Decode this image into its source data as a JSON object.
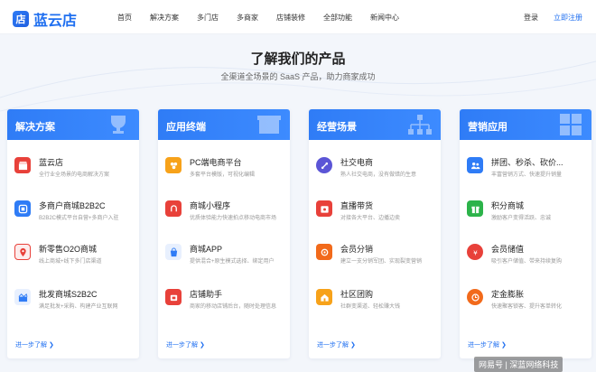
{
  "header": {
    "logo_mark": "店",
    "logo_text": "蓝云店",
    "nav": [
      "首页",
      "解决方案",
      "多门店",
      "多商家",
      "店铺装修",
      "全部功能",
      "新闻中心"
    ],
    "login": "登录",
    "register": "立即注册"
  },
  "hero": {
    "title": "了解我们的产品",
    "subtitle": "全渠道全场景的 SaaS 产品，助力商家成功"
  },
  "cards": [
    {
      "title": "解决方案",
      "more": "进一步了解 ❯",
      "items": [
        {
          "title": "蓝云店",
          "desc": "全行业全场景的电商解决方案",
          "icon": "store-icon",
          "color": "#e8413a"
        },
        {
          "title": "多商户商城B2B2C",
          "desc": "B2B2C模式平台自营+多商户入驻",
          "icon": "multi-store-icon",
          "color": "#2f7cf6"
        },
        {
          "title": "新零售O2O商城",
          "desc": "线上商城+线下多门店渠道",
          "icon": "location-icon",
          "color": "#e8413a"
        },
        {
          "title": "批发商城S2B2C",
          "desc": "满足批发+采购、构建产业互联网",
          "icon": "wholesale-icon",
          "color": "#2f7cf6"
        }
      ]
    },
    {
      "title": "应用终端",
      "more": "进一步了解 ❯",
      "items": [
        {
          "title": "PC端电商平台",
          "desc": "多套平台模版，可视化编辑",
          "icon": "pc-icon",
          "color": "#f7a21a"
        },
        {
          "title": "商城小程序",
          "desc": "优质体验能力快速拍点移动电商市场",
          "icon": "mini-program-icon",
          "color": "#e8413a"
        },
        {
          "title": "商城APP",
          "desc": "提供混合+原生模式选择、绑定用户",
          "icon": "app-icon",
          "color": "#2f7cf6"
        },
        {
          "title": "店铺助手",
          "desc": "商家的移动店铺后台，随时处理信息",
          "icon": "assistant-icon",
          "color": "#e8413a"
        }
      ]
    },
    {
      "title": "经营场景",
      "more": "进一步了解 ❯",
      "items": [
        {
          "title": "社交电商",
          "desc": "熟人社交电商，没有做错的生意",
          "icon": "social-icon",
          "color": "#5b55d6"
        },
        {
          "title": "直播带货",
          "desc": "对接各大平台、边播边卖",
          "icon": "live-icon",
          "color": "#e8413a"
        },
        {
          "title": "会员分销",
          "desc": "建立一支分销军团、实现裂变营销",
          "icon": "distribution-icon",
          "color": "#f26a1b"
        },
        {
          "title": "社区团购",
          "desc": "社群变渠道、轻松赚大钱",
          "icon": "community-icon",
          "color": "#f7a21a"
        }
      ]
    },
    {
      "title": "营销应用",
      "more": "进一步了解 ❯",
      "items": [
        {
          "title": "拼团、秒杀、砍价...",
          "desc": "丰富营销方式、快速提升销量",
          "icon": "group-buy-icon",
          "color": "#2f7cf6"
        },
        {
          "title": "积分商城",
          "desc": "激励客户变得活跃、忠诚",
          "icon": "points-icon",
          "color": "#2cb34a"
        },
        {
          "title": "会员储值",
          "desc": "吸引客户储值、带来持续复购",
          "icon": "stored-value-icon",
          "color": "#e8413a"
        },
        {
          "title": "定金膨胀",
          "desc": "快速聚客锁客、提升客单转化",
          "icon": "deposit-icon",
          "color": "#f26a1b"
        }
      ]
    }
  ],
  "watermark": "网易号 | 深蓝网络科技"
}
